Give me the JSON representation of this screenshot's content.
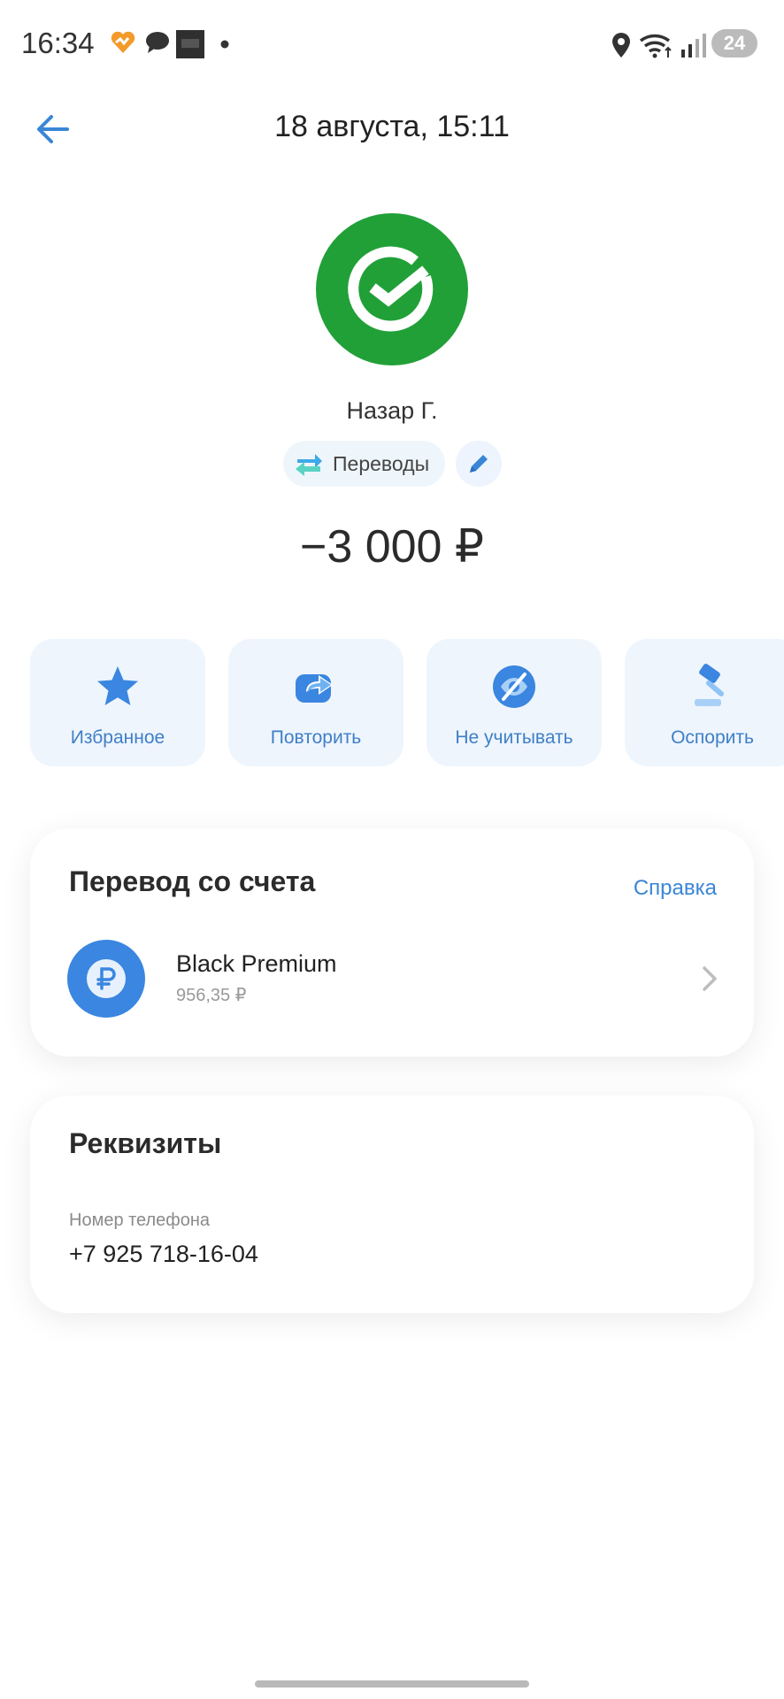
{
  "status_bar": {
    "time": "16:34",
    "battery": "24",
    "icons": [
      "heart-app-icon",
      "chat-icon",
      "image-thumbnail-icon",
      "dot-icon",
      "location-icon",
      "wifi-icon",
      "signal-icon",
      "battery-icon"
    ]
  },
  "header": {
    "title": "18 августа, 15:11",
    "back_icon": "arrow-left-icon"
  },
  "merchant": {
    "name": "Назар Г.",
    "logo": "sber-check-logo",
    "category": "Переводы",
    "amount": "−3 000 ₽"
  },
  "actions": [
    {
      "label": "Избранное",
      "icon": "star-icon"
    },
    {
      "label": "Повторить",
      "icon": "repeat-icon"
    },
    {
      "label": "Не учитывать",
      "icon": "eye-off-icon"
    },
    {
      "label": "Оспорить",
      "icon": "gavel-icon"
    }
  ],
  "transfer_card": {
    "title": "Перевод со счета",
    "help_label": "Справка",
    "account_name": "Black Premium",
    "account_balance": "956,35 ₽"
  },
  "details_card": {
    "title": "Реквизиты",
    "phone_label": "Номер телефона",
    "phone_value": "+7 925 718-16-04"
  },
  "colors": {
    "accent": "#3a86d6",
    "sber_green": "#21a038",
    "action_bg": "#eef5fd"
  }
}
